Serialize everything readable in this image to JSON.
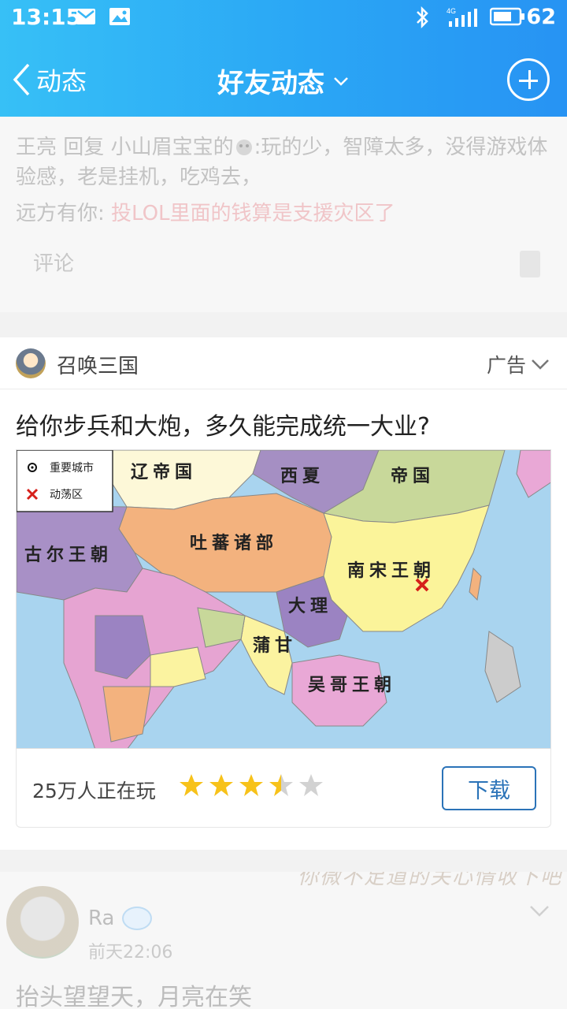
{
  "status_bar": {
    "time": "13:15",
    "network": "4G",
    "battery": "62"
  },
  "nav": {
    "back_label": "动态",
    "title": "好友动态"
  },
  "prev_post": {
    "reply_author": "王亮",
    "reply_word": "回复",
    "reply_target": "小山眉宝宝的",
    "reply_text": ":玩的少，智障太多，没得游戏体验感，老是挂机，吃鸡去，",
    "reply2_author": "远方有你:",
    "reply2_text": "投LOL里面的钱算是支援灾区了",
    "comment_label": "评论"
  },
  "ad": {
    "app_name": "召唤三国",
    "ad_label": "广告",
    "headline": "给你步兵和大炮，多久能完成统一大业?",
    "players": "25万人正在玩",
    "rating": 3.5,
    "download_label": "下载",
    "map": {
      "legend_city": "重要城市",
      "legend_unrest": "动荡区",
      "regions": [
        "辽帝国",
        "西夏",
        "帝国",
        "吐蕃诸部",
        "古尔王朝",
        "南宋王朝",
        "大理",
        "蒲甘",
        "吴哥王朝"
      ]
    }
  },
  "next_post": {
    "signature": "你微不足道的关心情收下吧",
    "user": "Ra",
    "date": "前天22:06",
    "content": "抬头望望天，月亮在笑"
  }
}
